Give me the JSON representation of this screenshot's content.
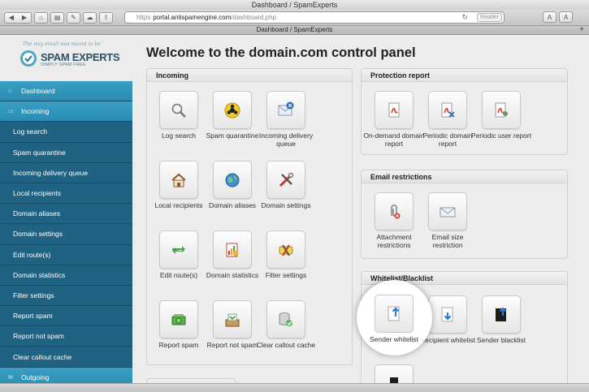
{
  "browser": {
    "window_title": "Dashboard / SpamExperts",
    "tab_title": "Dashboard / SpamExperts",
    "url_protocol": "https",
    "url_host": "portal.antispamengine.com",
    "url_path": "/dashboard.php",
    "reader_label": "Reader",
    "font_small": "A",
    "font_large": "A",
    "tab_plus": "+"
  },
  "logo": {
    "tagline": "The way email was meant to be",
    "name": "SPAM EXPERTS",
    "subtitle": "SIMPLY SPAM FREE"
  },
  "page_title": "Welcome to the domain.com control panel",
  "sidebar": {
    "items": [
      {
        "label": "Dashboard",
        "type": "head",
        "icon": "home-icon"
      },
      {
        "label": "Incoming",
        "type": "head",
        "icon": "inbox-icon"
      },
      {
        "label": "Log search",
        "type": "sub"
      },
      {
        "label": "Spam quarantine",
        "type": "sub"
      },
      {
        "label": "Incoming delivery queue",
        "type": "sub"
      },
      {
        "label": "Local recipients",
        "type": "sub"
      },
      {
        "label": "Domain aliases",
        "type": "sub"
      },
      {
        "label": "Domain settings",
        "type": "sub"
      },
      {
        "label": "Edit route(s)",
        "type": "sub"
      },
      {
        "label": "Domain statistics",
        "type": "sub"
      },
      {
        "label": "Filter settings",
        "type": "sub"
      },
      {
        "label": "Report spam",
        "type": "sub"
      },
      {
        "label": "Report not spam",
        "type": "sub"
      },
      {
        "label": "Clear callout cache",
        "type": "sub"
      },
      {
        "label": "Outgoing",
        "type": "head",
        "icon": "outbox-icon"
      }
    ]
  },
  "incoming": {
    "title": "Incoming",
    "tiles": [
      {
        "label": "Log search",
        "icon": "magnifier-icon"
      },
      {
        "label": "Spam quarantine",
        "icon": "biohazard-icon"
      },
      {
        "label": "Incoming delivery queue",
        "icon": "queue-icon"
      },
      {
        "label": "Local recipients",
        "icon": "house-icon"
      },
      {
        "label": "Domain aliases",
        "icon": "globe-icon"
      },
      {
        "label": "Domain settings",
        "icon": "tools-icon"
      },
      {
        "label": "Edit route(s)",
        "icon": "arrows-icon"
      },
      {
        "label": "Domain statistics",
        "icon": "chart-icon"
      },
      {
        "label": "Filter settings",
        "icon": "filter-icon"
      },
      {
        "label": "Report spam",
        "icon": "money-icon"
      },
      {
        "label": "Report not spam",
        "icon": "tray-icon"
      },
      {
        "label": "Clear callout cache",
        "icon": "database-icon"
      }
    ]
  },
  "protection": {
    "title": "Protection report",
    "tiles": [
      {
        "label": "On-demand domain report",
        "icon": "pdf-icon"
      },
      {
        "label": "Periodic domain report",
        "icon": "pdf-clock-icon"
      },
      {
        "label": "Periodic user report",
        "icon": "pdf-user-icon"
      }
    ]
  },
  "restrictions": {
    "title": "Email restrictions",
    "tiles": [
      {
        "label": "Attachment restrictions",
        "icon": "paperclip-icon"
      },
      {
        "label": "Email size restriction",
        "icon": "envelope-icon"
      }
    ]
  },
  "whitelist": {
    "title": "Whitelist/Blacklist",
    "tiles": [
      {
        "label": "Sender whitelist",
        "icon": "doc-up-icon"
      },
      {
        "label": "Recipient whitelist",
        "icon": "doc-down-icon"
      },
      {
        "label": "Sender blacklist",
        "icon": "black-doc-icon"
      }
    ]
  },
  "colors": {
    "sidebar_bg": "#1d5d78",
    "sidebar_head": "#2a8cb1",
    "accent_blue": "#2b7fd0"
  }
}
